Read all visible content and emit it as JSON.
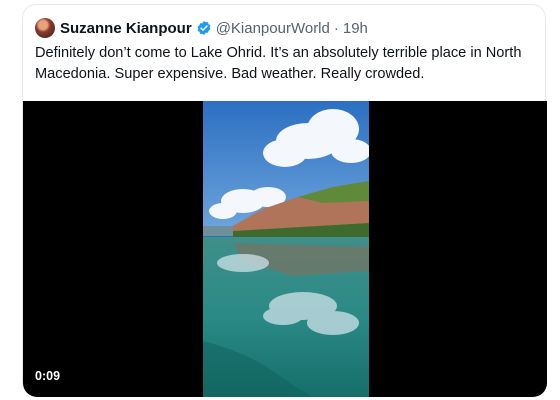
{
  "tweet": {
    "author_name": "Suzanne Kianpour",
    "handle": "@KianpourWorld",
    "separator": "·",
    "time": "19h",
    "text": "Definitely don’t come to Lake Ohrid. It’s an absolutely terrible place in North Macedonia. Super expensive. Bad weather. Really crowded.",
    "verified_icon": "verified-badge-icon"
  },
  "media": {
    "type": "video",
    "duration": "0:09"
  },
  "colors": {
    "verified": "#1d9bf0",
    "secondary_text": "#536471",
    "card_border": "#e6e9ec"
  }
}
